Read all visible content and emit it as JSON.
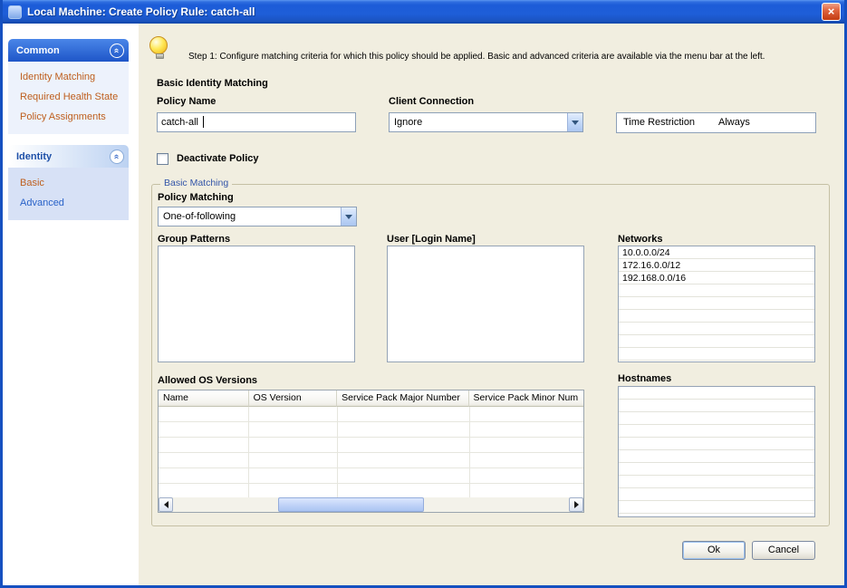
{
  "window": {
    "title": "Local Machine: Create Policy Rule: catch-all"
  },
  "icons": {
    "close": "×",
    "chevron_up": "»"
  },
  "sidebar": {
    "sections": [
      {
        "header": "Common",
        "items": [
          "Identity Matching",
          "Required Health State",
          "Policy Assignments"
        ]
      },
      {
        "header": "Identity",
        "items": [
          "Basic",
          "Advanced"
        ]
      }
    ]
  },
  "step": {
    "text": "Step 1: Configure matching criteria for which this policy should be applied. Basic and advanced criteria are available via the menu bar at the left."
  },
  "form": {
    "section_heading": "Basic Identity Matching",
    "policy_name": {
      "label": "Policy Name",
      "value": "catch-all"
    },
    "client_connection": {
      "label": "Client Connection",
      "value": "Ignore"
    },
    "time_restriction": {
      "label": "Time Restriction",
      "value": "Always"
    },
    "deactivate_policy": {
      "label": "Deactivate Policy",
      "checked": false
    },
    "basic_matching": {
      "legend": "Basic Matching",
      "policy_matching": {
        "label": "Policy Matching",
        "value": "One-of-following"
      },
      "group_patterns": {
        "label": "Group Patterns",
        "items": []
      },
      "user_login": {
        "label": "User [Login Name]",
        "items": []
      },
      "networks": {
        "label": "Networks",
        "items": [
          "10.0.0.0/24",
          "172.16.0.0/12",
          "192.168.0.0/16"
        ]
      },
      "allowed_os": {
        "label": "Allowed OS Versions",
        "columns": [
          "Name",
          "OS Version",
          "Service Pack Major Number",
          "Service Pack Minor Num"
        ],
        "rows": []
      },
      "hostnames": {
        "label": "Hostnames",
        "items": []
      }
    }
  },
  "buttons": {
    "ok": "Ok",
    "cancel": "Cancel"
  }
}
